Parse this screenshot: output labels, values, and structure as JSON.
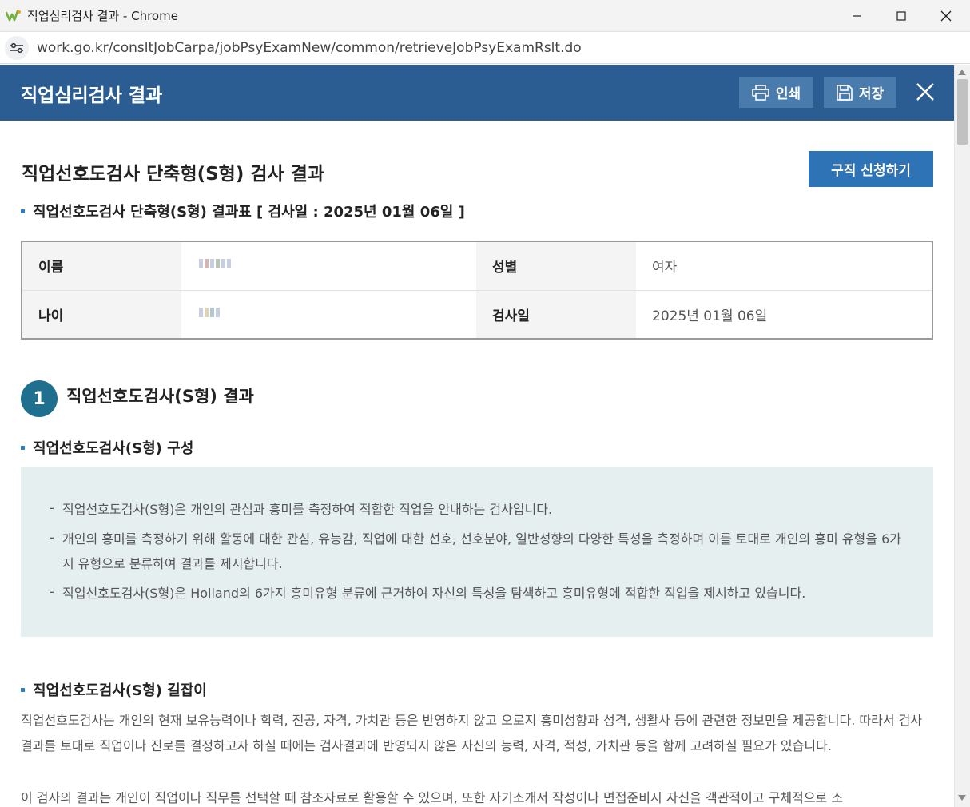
{
  "window": {
    "title": "직업심리검사 결과 - Chrome",
    "url": "work.go.kr/consltJobCarpa/jobPsyExamNew/common/retrieveJobPsyExamRslt.do"
  },
  "modal": {
    "title": "직업심리검사 결과",
    "print_label": "인쇄",
    "save_label": "저장"
  },
  "page": {
    "title": "직업선호도검사 단축형(S형) 검사 결과",
    "apply_button": "구직 신청하기",
    "result_table_heading": "직업선호도검사 단축형(S형) 결과표 [ 검사일 : 2025년 01월 06일 ]"
  },
  "profile": {
    "name_label": "이름",
    "gender_label": "성별",
    "gender_value": "여자",
    "age_label": "나이",
    "exam_date_label": "검사일",
    "exam_date_value": "2025년 01월 06일"
  },
  "section1": {
    "number": "1",
    "title": "직업선호도검사(S형) 결과",
    "composition_heading": "직업선호도검사(S형) 구성",
    "composition_items": [
      "직업선호도검사(S형)은 개인의 관심과 흥미를 측정하여 적합한 직업을 안내하는 검사입니다.",
      "개인의 흥미를 측정하기 위해 활동에 대한 관심, 유능감, 직업에 대한 선호, 선호분야, 일반성향의 다양한 특성을 측정하며 이를 토대로 개인의 흥미 유형을 6가지 유형으로 분류하여 결과를 제시합니다.",
      "직업선호도검사(S형)은 Holland의 6가지 흥미유형 분류에 근거하여 자신의 특성을 탐색하고 흥미유형에 적합한 직업을 제시하고 있습니다."
    ],
    "guide_heading": "직업선호도검사(S형) 길잡이",
    "guide_paragraph1": "직업선호도검사는 개인의 현재 보유능력이나 학력, 전공, 자격, 가치관 등은 반영하지 않고 오로지 흥미성향과 성격, 생활사 등에 관련한 정보만을 제공합니다. 따라서 검사결과를 토대로 직업이나 진로를 결정하고자 하실 때에는 검사결과에 반영되지 않은 자신의 능력, 자격, 적성, 가치관 등을 함께 고려하실 필요가 있습니다.",
    "guide_paragraph2": "이 검사의 결과는 개인이 직업이나 직무를 선택할 때 참조자료로 활용할 수 있으며, 또한 자기소개서 작성이나 면접준비시 자신을 객관적이고 구체적으로 소"
  }
}
